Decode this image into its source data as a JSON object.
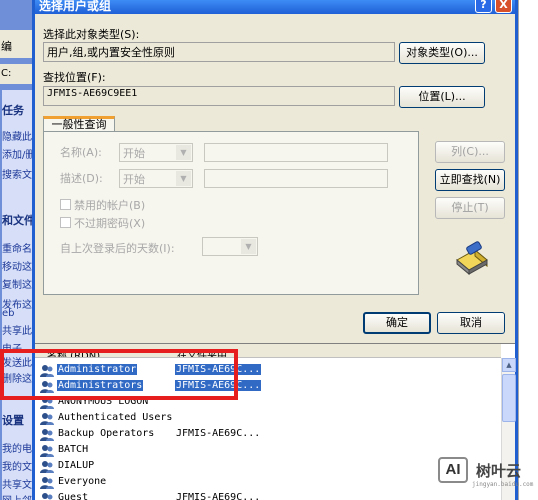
{
  "background_window": {
    "toolbar_label": "编",
    "address_label": "C:",
    "sections": [
      {
        "heading": "任务",
        "items": [
          "隐藏此",
          "添加/删",
          "搜索文"
        ]
      },
      {
        "heading": "和文件",
        "items": [
          "重命名",
          "移动这",
          "复制这",
          "发布这",
          "eb",
          "共享此",
          "电子",
          "发送此",
          "删除这"
        ]
      },
      {
        "heading": "设置",
        "items": [
          "我的电",
          "我的文",
          "共享文",
          "网上邻"
        ]
      }
    ]
  },
  "dialog": {
    "title": "选择用户或组",
    "help_button": "?",
    "close_button": "X",
    "object_type_label": "选择此对象类型(S):",
    "object_type_value": "用户,组,或内置安全性原则",
    "object_types_button": "对象类型(O)...",
    "location_label": "查找位置(F):",
    "location_value": "JFMIS-AE69C9EE1",
    "locations_button": "位置(L)...",
    "tab_label": "一般性查询",
    "name_label": "名称(A):",
    "name_combo": "开始",
    "desc_label": "描述(D):",
    "desc_combo": "开始",
    "disabled_accounts_label": "禁用的帐户(B)",
    "non_expiring_label": "不过期密码(X)",
    "days_since_logon_label": "自上次登录后的天数(I):",
    "columns_button": "列(C)...",
    "find_now_button": "立即查找(N)",
    "stop_button": "停止(T)",
    "ok_button": "确定",
    "cancel_button": "取消"
  },
  "results": {
    "columns": [
      "名称 (RDN)",
      "在文件夹中"
    ],
    "rows": [
      {
        "name": "Administrator",
        "folder": "JFMIS-AE69C...",
        "selected": true
      },
      {
        "name": "Administrators",
        "folder": "JFMIS-AE69C...",
        "selected": true
      },
      {
        "name": "ANONYMOUS LOGON",
        "folder": "",
        "selected": false
      },
      {
        "name": "Authenticated Users",
        "folder": "",
        "selected": false
      },
      {
        "name": "Backup Operators",
        "folder": "JFMIS-AE69C...",
        "selected": false
      },
      {
        "name": "BATCH",
        "folder": "",
        "selected": false
      },
      {
        "name": "DIALUP",
        "folder": "",
        "selected": false
      },
      {
        "name": "Everyone",
        "folder": "",
        "selected": false
      },
      {
        "name": "Guest",
        "folder": "JFMIS-AE69C...",
        "selected": false
      }
    ]
  },
  "watermark": {
    "logo": "AI",
    "text": "树叶云",
    "sub": "jingyan.baidu.com"
  },
  "colors": {
    "highlight_box": "#e61e1e",
    "selection": "#316ac5",
    "title_bar": "#1f5fd6"
  }
}
